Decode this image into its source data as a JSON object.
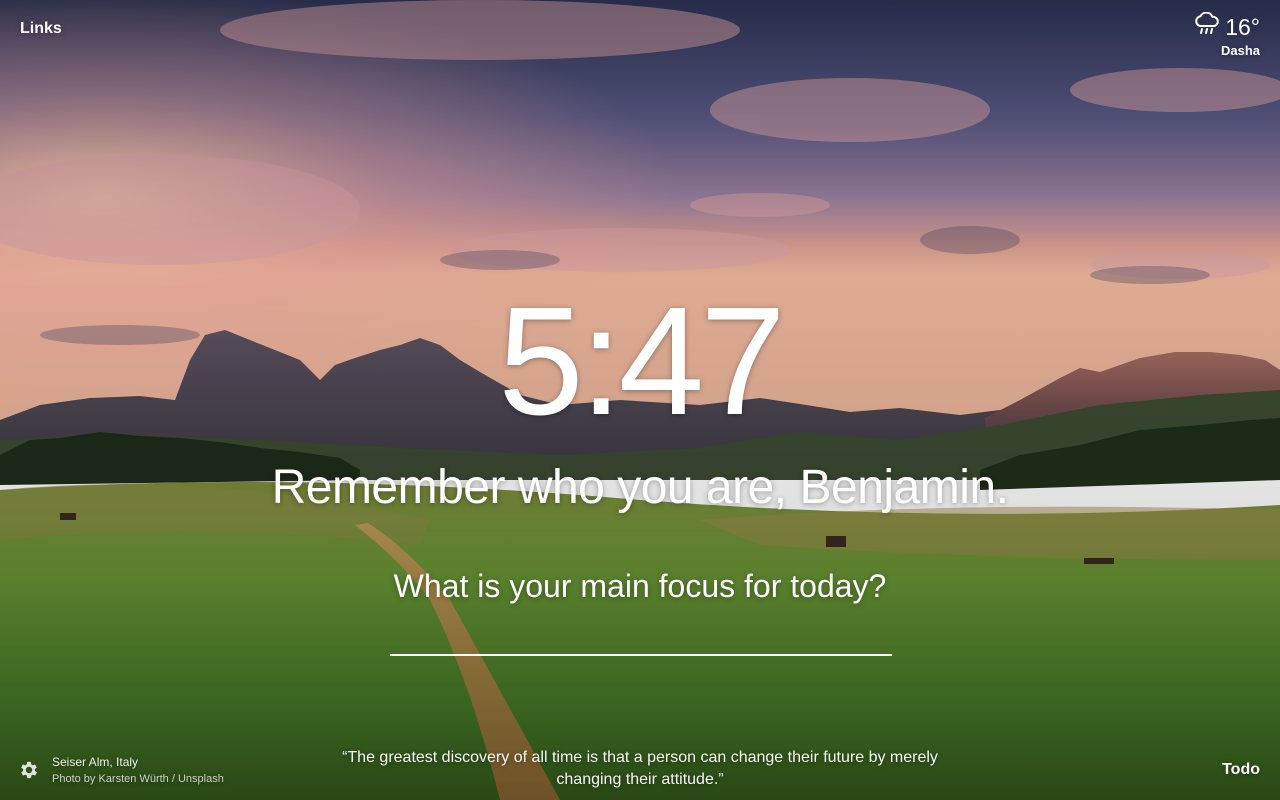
{
  "header": {
    "links_label": "Links"
  },
  "weather": {
    "icon": "cloud-rain-icon",
    "temperature": "16°",
    "location": "Dasha"
  },
  "main": {
    "time": "5:47",
    "greeting": "Remember who you are, Benjamin.",
    "focus_prompt": "What is your main focus for today?",
    "focus_value": ""
  },
  "footer": {
    "settings_icon": "gear-icon",
    "photo_location": "Seiser Alm, Italy",
    "photo_credit": "Photo by Karsten Würth / Unsplash",
    "quote": "“The greatest discovery of all time is that a person can change their future by merely changing their attitude.”",
    "todo_label": "Todo"
  },
  "colors": {
    "text": "#ffffff",
    "sky_top": "#3a3f66",
    "sky_glow": "#e39a8e",
    "grass": "#5f8a2f"
  }
}
